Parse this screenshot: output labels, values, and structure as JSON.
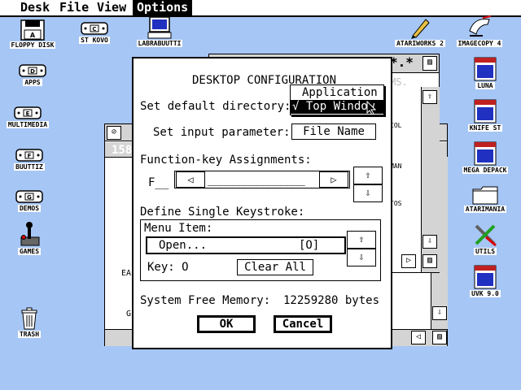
{
  "menubar": {
    "items": [
      {
        "label": "Desk",
        "active": false
      },
      {
        "label": "File",
        "active": false
      },
      {
        "label": "View",
        "active": false
      },
      {
        "label": "Options",
        "active": true
      }
    ]
  },
  "desktop_icons": {
    "floppy": "FLOPPY DISK",
    "stkovo": "ST KOVO",
    "labra": "LABRABUUTTI",
    "atariworks": "ATARIWORKS 2",
    "imagecopy": "IMAGECOPY 4",
    "apps": "APPS",
    "luna": "LUNA",
    "multimedia": "MULTIMEDIA",
    "knife": "KNIFE ST",
    "buuttiz": "BUUTTIZ",
    "megadepack": "MEGA DEPACK",
    "demos": "DEMOS",
    "atarimania": "ATARIMANIA",
    "games": "GAMES",
    "utils": "UTILS",
    "uvk": "UVK 9.0",
    "trash": "TRASH",
    "drive_letters": {
      "floppy": "A",
      "stkovo": "C",
      "apps": "D",
      "multimedia": "E",
      "buuttiz": "F",
      "demos": "G"
    }
  },
  "bg_windows": {
    "right_title": "*.*",
    "right_row_col": "COL",
    "right_row_man": "MAN",
    "right_row_tos": "TOS",
    "right_mid": "MS.",
    "left_number": "158",
    "left_ea": "EA",
    "left_g": "G"
  },
  "dialog": {
    "title": "DESKTOP CONFIGURATION",
    "default_dir_label": "Set default directory:",
    "input_param_label": "Set input parameter:",
    "input_param_value": "File Name",
    "fkey_label": "Function-key Assignments:",
    "fkey_value": "F__",
    "fkey_blank": "________________",
    "keystroke_label": "Define Single Keystroke:",
    "menu_item_label": "Menu Item:",
    "menu_item_value": "Open...",
    "menu_item_key": "[O]",
    "key_label": "Key: O",
    "clear_all": "Clear All",
    "memory_label": "System Free Memory:",
    "memory_value": "12259280 bytes",
    "ok": "OK",
    "cancel": "Cancel"
  },
  "popup": {
    "items": [
      {
        "label": "Application",
        "selected": false
      },
      {
        "label": "√ Top Window",
        "selected": true
      }
    ]
  },
  "icons": {
    "left": "◁",
    "right": "▷",
    "up": "⇧",
    "down": "⇩",
    "fuller": "▨",
    "close": "⊘"
  }
}
